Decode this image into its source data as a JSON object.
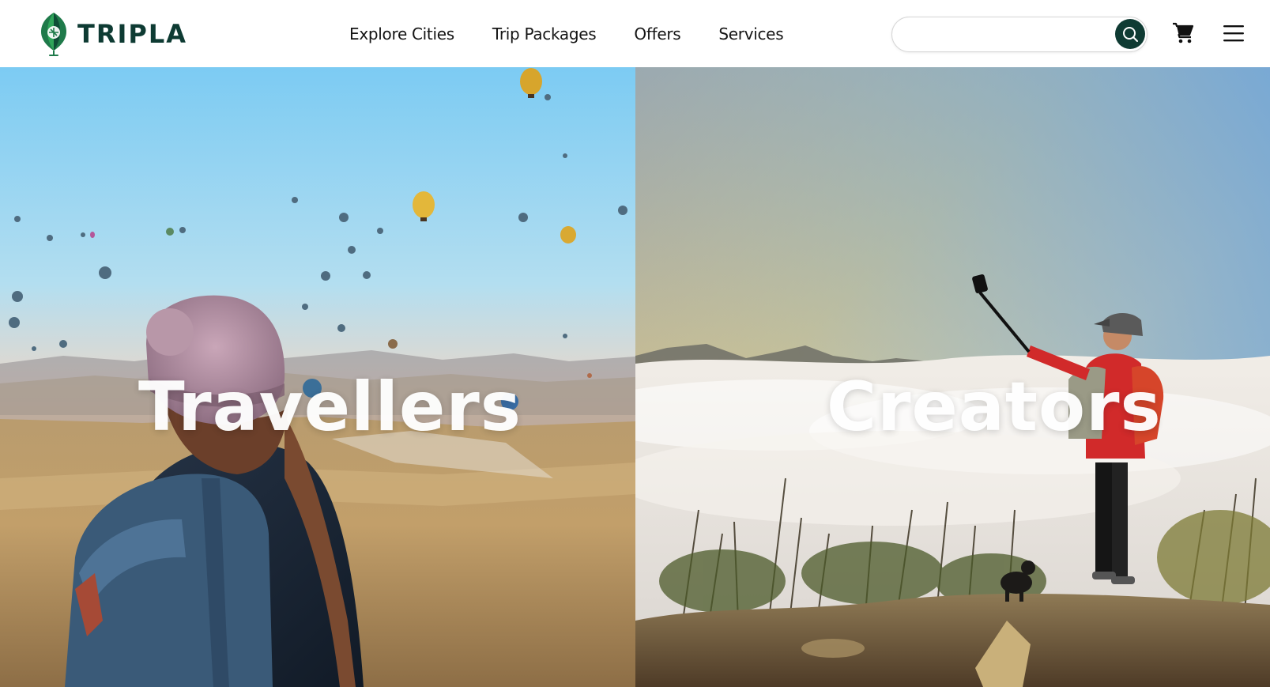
{
  "brand": {
    "name": "TRIPLA",
    "primary_color": "#0f3b33",
    "accent_color": "#2e9e4f"
  },
  "nav": {
    "links": [
      "Explore Cities",
      "Trip Packages",
      "Offers",
      "Services"
    ]
  },
  "search": {
    "placeholder": "",
    "icon": "search-icon"
  },
  "header_icons": {
    "cart": "shopping-cart-icon",
    "menu": "hamburger-menu-icon"
  },
  "hero": {
    "left": {
      "title": "Travellers",
      "image": "traveller-with-beanie-watching-hot-air-balloons"
    },
    "right": {
      "title": "Creators",
      "image": "creator-with-selfie-stick-above-clouds"
    }
  }
}
